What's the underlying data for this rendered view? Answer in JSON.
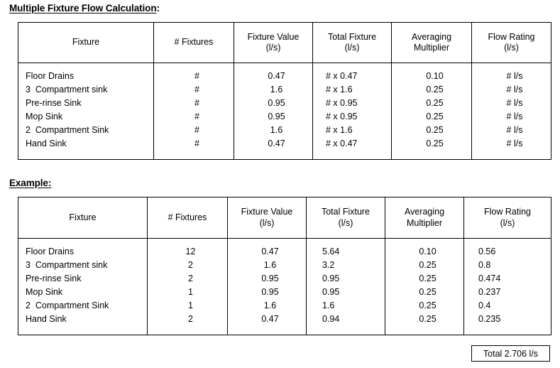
{
  "sections": {
    "calc": {
      "heading_main": "Multiple Fixture Flow Calculation",
      "heading_tail": ":"
    },
    "example": {
      "heading_main": "Example:",
      "heading_tail": ""
    }
  },
  "columns": [
    {
      "line1": "Fixture",
      "line2": ""
    },
    {
      "line1": "# Fixtures",
      "line2": ""
    },
    {
      "line1": "Fixture Value",
      "line2": "(l/s)"
    },
    {
      "line1": "Total Fixture",
      "line2": "(l/s)"
    },
    {
      "line1": "Averaging",
      "line2": "Multiplier"
    },
    {
      "line1": "Flow Rating",
      "line2": "(l/s)"
    }
  ],
  "calc_table": {
    "fixtures": [
      "Floor Drains",
      "3  Compartment sink",
      "Pre-rinse Sink",
      "Mop Sink",
      "2  Compartment Sink",
      "Hand Sink"
    ],
    "num_fixtures": [
      "#",
      "#",
      "#",
      "#",
      "#",
      "#"
    ],
    "fixture_value": [
      "0.47",
      "1.6",
      "0.95",
      "0.95",
      "1.6",
      "0.47"
    ],
    "total_fixture": [
      "# x 0.47",
      "# x 1.6",
      "# x 0.95",
      "# x 0.95",
      "# x 1.6",
      "# x 0.47"
    ],
    "averaging_multiplier": [
      "0.10",
      "0.25",
      "0.25",
      "0.25",
      "0.25",
      "0.25"
    ],
    "flow_rating": [
      "# l/s",
      "# l/s",
      "# l/s",
      "# l/s",
      "# l/s",
      "# l/s"
    ]
  },
  "example_table": {
    "fixtures": [
      "Floor Drains",
      "3  Compartment sink",
      "Pre-rinse Sink",
      "Mop Sink",
      "2  Compartment Sink",
      "Hand Sink"
    ],
    "num_fixtures": [
      "12",
      "2",
      "2",
      "1",
      "1",
      "2"
    ],
    "fixture_value": [
      "0.47",
      "1.6",
      "0.95",
      "0.95",
      "1.6",
      "0.47"
    ],
    "total_fixture": [
      "5.64",
      "3.2",
      "0.95",
      "0.95",
      "1.6",
      "0.94"
    ],
    "averaging_multiplier": [
      "0.10",
      "0.25",
      "0.25",
      "0.25",
      "0.25",
      "0.25"
    ],
    "flow_rating": [
      "0.56",
      "0.8",
      "0.474",
      "0.237",
      "0.4",
      "0.235"
    ]
  },
  "total": {
    "label": "Total 2.706 l/s"
  },
  "colors": {
    "text": "#000000",
    "border": "#000000",
    "background": "#ffffff"
  }
}
